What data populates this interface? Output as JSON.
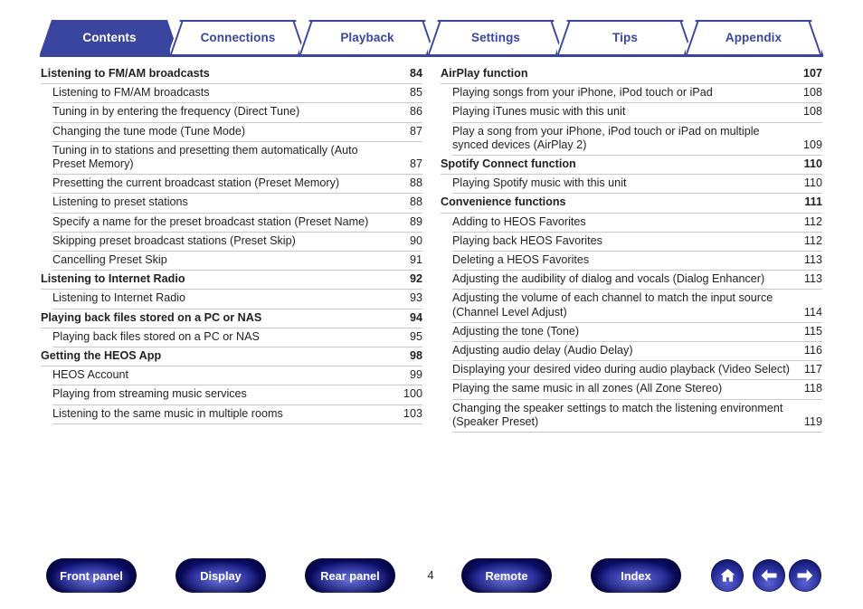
{
  "document": {
    "page_number": "4"
  },
  "tabs": [
    {
      "label": "Contents",
      "active": true
    },
    {
      "label": "Connections",
      "active": false
    },
    {
      "label": "Playback",
      "active": false
    },
    {
      "label": "Settings",
      "active": false
    },
    {
      "label": "Tips",
      "active": false
    },
    {
      "label": "Appendix",
      "active": false
    }
  ],
  "toc": {
    "left_column": [
      {
        "level": 1,
        "title": "Listening to FM/AM broadcasts",
        "page": "84"
      },
      {
        "level": 2,
        "title": "Listening to FM/AM broadcasts",
        "page": "85"
      },
      {
        "level": 2,
        "title": "Tuning in by entering the frequency (Direct Tune)",
        "page": "86"
      },
      {
        "level": 2,
        "title": "Changing the tune mode (Tune Mode)",
        "page": "87"
      },
      {
        "level": 2,
        "title": "Tuning in to stations and presetting them automatically (Auto Preset Memory)",
        "page": "87"
      },
      {
        "level": 2,
        "title": "Presetting the current broadcast station (Preset Memory)",
        "page": "88"
      },
      {
        "level": 2,
        "title": "Listening to preset stations",
        "page": "88"
      },
      {
        "level": 2,
        "title": "Specify a name for the preset broadcast station (Preset Name)",
        "page": "89"
      },
      {
        "level": 2,
        "title": "Skipping preset broadcast stations (Preset Skip)",
        "page": "90"
      },
      {
        "level": 2,
        "title": "Cancelling Preset Skip",
        "page": "91"
      },
      {
        "level": 1,
        "title": "Listening to Internet Radio",
        "page": "92"
      },
      {
        "level": 2,
        "title": "Listening to Internet Radio",
        "page": "93"
      },
      {
        "level": 1,
        "title": "Playing back files stored on a PC or NAS",
        "page": "94"
      },
      {
        "level": 2,
        "title": "Playing back files stored on a PC or NAS",
        "page": "95"
      },
      {
        "level": 1,
        "title": "Getting the HEOS App",
        "page": "98"
      },
      {
        "level": 2,
        "title": "HEOS Account",
        "page": "99"
      },
      {
        "level": 2,
        "title": "Playing from streaming music services",
        "page": "100"
      },
      {
        "level": 2,
        "title": "Listening to the same music in multiple rooms",
        "page": "103"
      }
    ],
    "right_column": [
      {
        "level": 1,
        "title": "AirPlay function",
        "page": "107"
      },
      {
        "level": 2,
        "title": "Playing songs from your iPhone, iPod touch or iPad",
        "page": "108"
      },
      {
        "level": 2,
        "title": "Playing iTunes music with this unit",
        "page": "108"
      },
      {
        "level": 2,
        "title": "Play a song from your iPhone, iPod touch or iPad on multiple synced devices (AirPlay 2)",
        "page": "109"
      },
      {
        "level": 1,
        "title": "Spotify Connect function",
        "page": "110"
      },
      {
        "level": 2,
        "title": "Playing Spotify music with this unit",
        "page": "110"
      },
      {
        "level": 1,
        "title": "Convenience functions",
        "page": "111"
      },
      {
        "level": 2,
        "title": "Adding to HEOS Favorites",
        "page": "112"
      },
      {
        "level": 2,
        "title": "Playing back HEOS Favorites",
        "page": "112"
      },
      {
        "level": 2,
        "title": "Deleting a HEOS Favorites",
        "page": "113"
      },
      {
        "level": 2,
        "title": "Adjusting the audibility of dialog and vocals (Dialog Enhancer)",
        "page": "113"
      },
      {
        "level": 2,
        "title": "Adjusting the volume of each channel to match the input source (Channel Level Adjust)",
        "page": "114"
      },
      {
        "level": 2,
        "title": "Adjusting the tone (Tone)",
        "page": "115"
      },
      {
        "level": 2,
        "title": "Adjusting audio delay (Audio Delay)",
        "page": "116"
      },
      {
        "level": 2,
        "title": "Displaying your desired video during audio playback (Video Select)",
        "page": "117"
      },
      {
        "level": 2,
        "title": "Playing the same music in all zones (All Zone Stereo)",
        "page": "118"
      },
      {
        "level": 2,
        "title": "Changing the speaker settings to match the listening environment (Speaker Preset)",
        "page": "119"
      }
    ]
  },
  "footer": {
    "buttons": [
      {
        "label": "Front panel"
      },
      {
        "label": "Display"
      },
      {
        "label": "Rear panel"
      },
      {
        "label": "Remote"
      },
      {
        "label": "Index"
      }
    ],
    "icons": [
      {
        "name": "home-icon"
      },
      {
        "name": "arrow-left-icon"
      },
      {
        "name": "arrow-right-icon"
      }
    ]
  },
  "colors": {
    "brand_blue": "#3a45a0",
    "rule_gray": "#c9c9c9",
    "text": "#231f20"
  }
}
